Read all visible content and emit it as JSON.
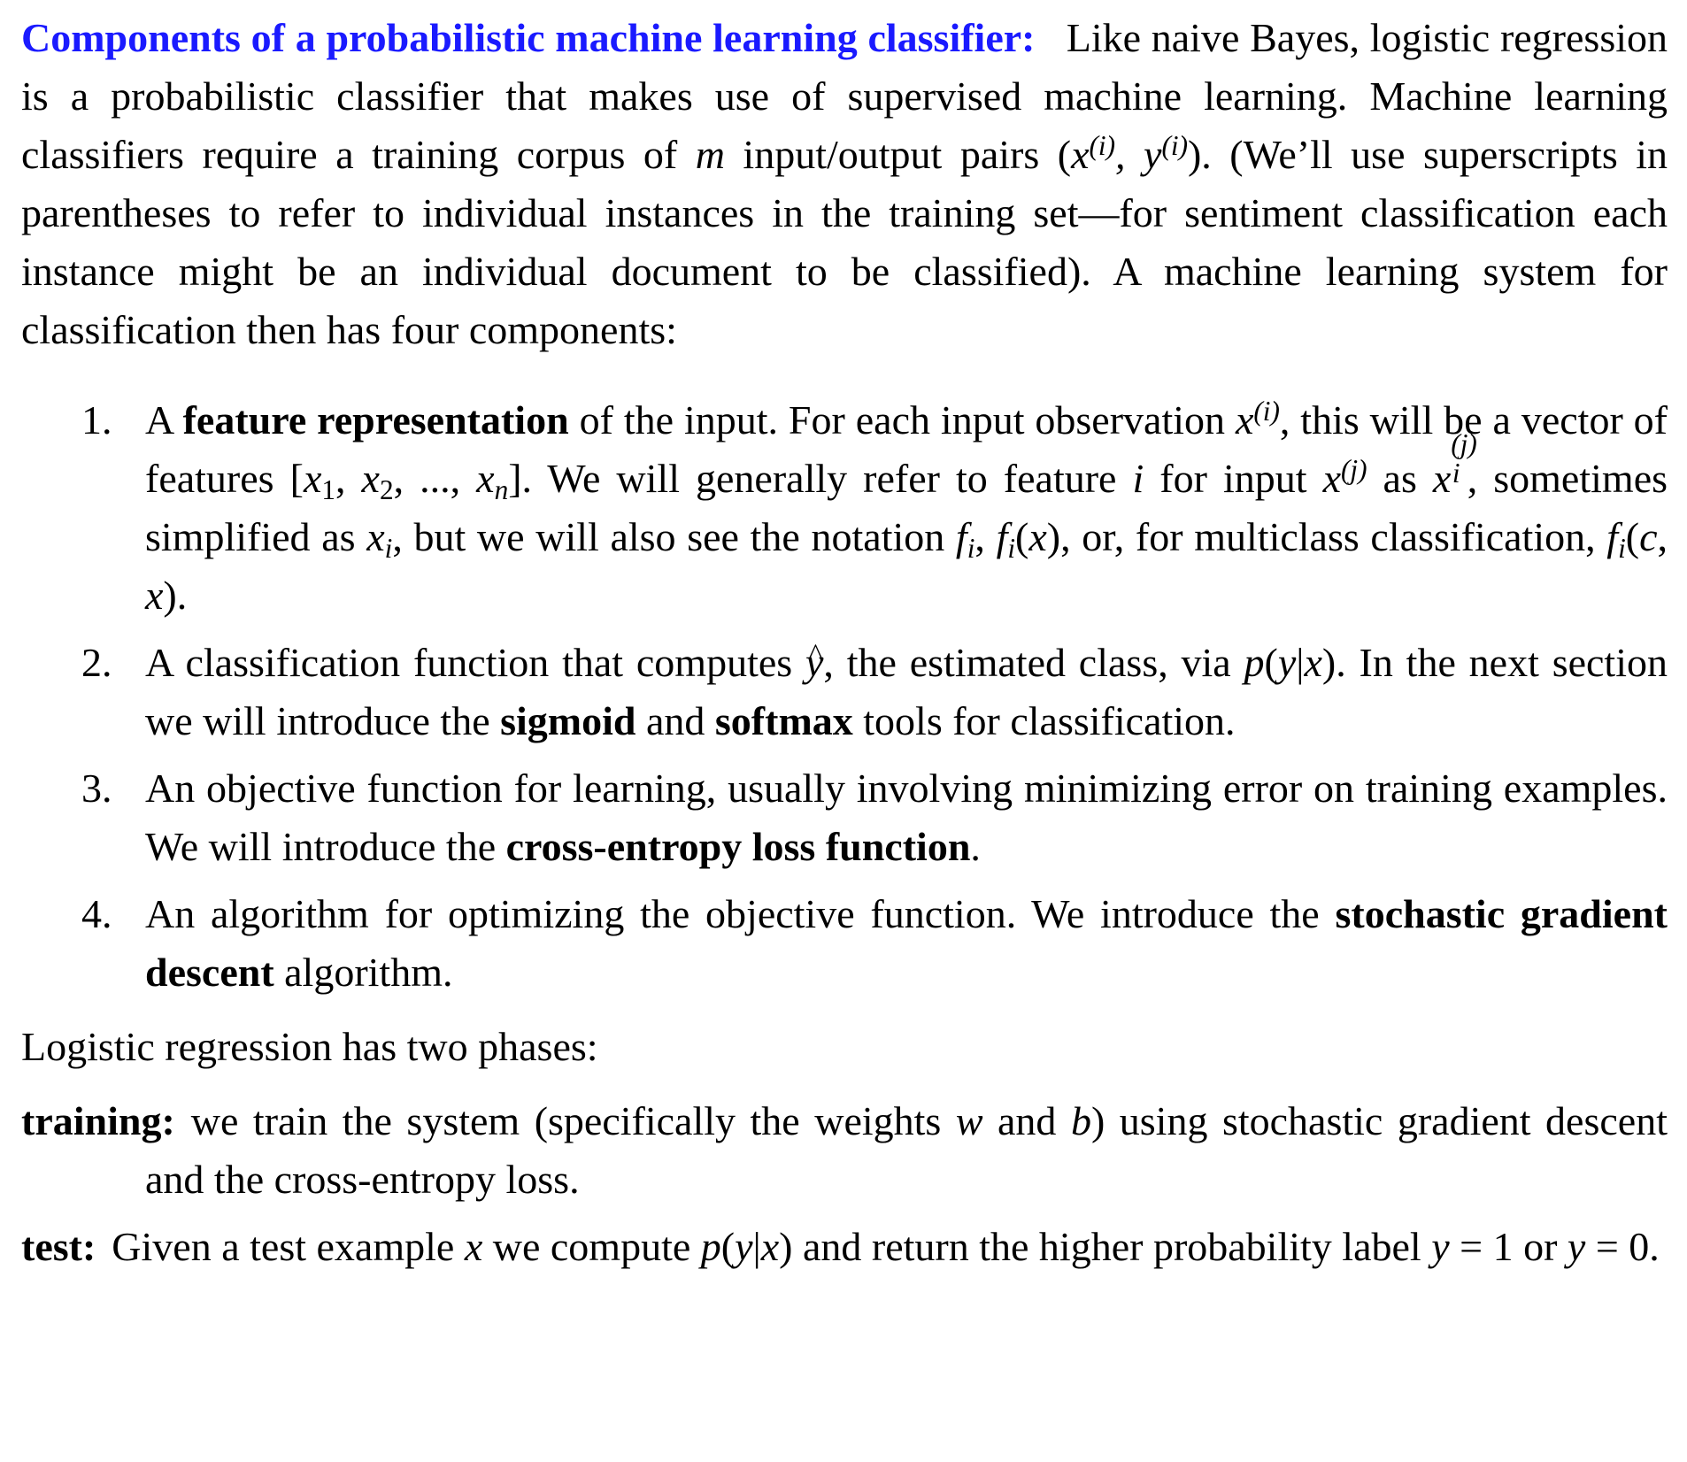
{
  "intro": {
    "heading": "Components of a probabilistic machine learning classifier:",
    "text_1": "Like naive Bayes, logistic regression is a probabilistic classifier that makes use of supervised machine learning. Machine learning classifiers require a training corpus of ",
    "var_m": "m",
    "text_2": " input/output pairs (",
    "text_3": "). (We’ll use superscripts in parentheses to refer to individual instances in the training set—for sentiment classification each instance might be an individual document to be classified). A machine learning system for classification then has four components:"
  },
  "components": [
    {
      "number": "1.",
      "text_1": "A ",
      "bold_1": "feature representation",
      "text_2": " of the input. For each input observation ",
      "text_3": ", this will be a vector of features ",
      "text_4": ". We will generally refer to feature ",
      "text_5": " for input ",
      "text_6": " as ",
      "text_7": ", sometimes simplified as ",
      "text_8": ", but we will also see the notation ",
      "text_9": ", or, for multiclass classification, ",
      "text_10": "."
    },
    {
      "number": "2.",
      "text_1": "A classification function that computes ",
      "text_2": ", the estimated class, via ",
      "text_3": ". In the next section we will introduce the ",
      "bold_1": "sigmoid",
      "text_4": " and ",
      "bold_2": "softmax",
      "text_5": " tools for classifi­cation."
    },
    {
      "number": "3.",
      "text_1": "An objective function for learning, usually involving minimizing error on training examples. We will introduce the ",
      "bold_1": "cross-entropy loss function",
      "text_2": "."
    },
    {
      "number": "4.",
      "text_1": "An algorithm for optimizing the objective function. We introduce the ",
      "bold_1": "stochas­tic gradient descent",
      "text_2": " algorithm."
    }
  ],
  "phases_intro": "Logistic regression has two phases:",
  "phases": {
    "training": {
      "term": "training:",
      "text_1": "we train the system (specifically the weights ",
      "var_w": "w",
      "text_2": " and ",
      "var_b": "b",
      "text_3": ") using stochastic gradient descent and the cross-entropy loss."
    },
    "test": {
      "term": "test:",
      "text_1": "Given a test example ",
      "var_x": "x",
      "text_2": " we compute ",
      "text_3": " and return the higher probability label ",
      "text_4": " or ",
      "text_5": "."
    }
  }
}
